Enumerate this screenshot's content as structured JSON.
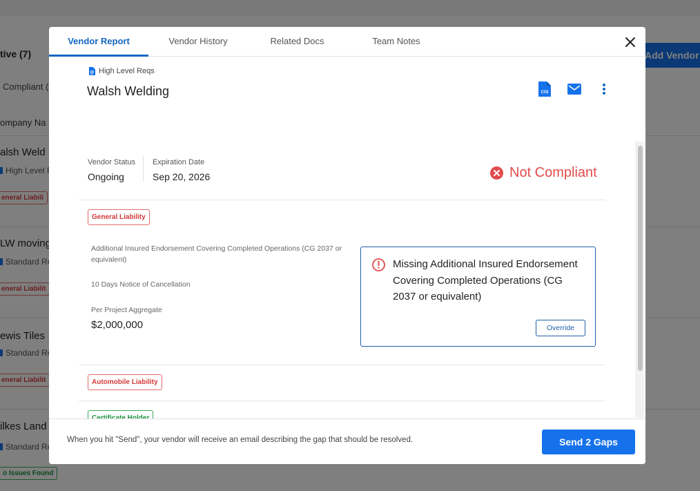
{
  "background": {
    "tab_label": "tive (7)",
    "add_vendor_label": "Add Vendor",
    "filter_label": "Compliant (",
    "column_header": "ompany Na",
    "rows": [
      {
        "name": "alsh Weld",
        "sub": "High Level R",
        "badge": "eneral Liabili"
      },
      {
        "name": "LW moving",
        "sub": "Standard Re",
        "badge": "eneral Liabilit"
      },
      {
        "name": "ewis Tiles",
        "sub": "Standard Re",
        "badge": "eneral Liabilit"
      },
      {
        "name": "ilkes Land",
        "sub": "Standard Re",
        "badge": "o Issues Found"
      }
    ]
  },
  "tabs": [
    {
      "label": "Vendor Report",
      "active": true
    },
    {
      "label": "Vendor History",
      "active": false
    },
    {
      "label": "Related Docs",
      "active": false
    },
    {
      "label": "Team Notes",
      "active": false
    }
  ],
  "vendor": {
    "requirements_set": "High Level Reqs",
    "name": "Walsh Welding",
    "status_label": "Vendor Status",
    "status_value": "Ongoing",
    "expiration_label": "Expiration Date",
    "expiration_value": "Sep 20, 2026",
    "compliance": "Not Compliant",
    "coi_icon_text": "COI"
  },
  "sections": {
    "general_liability": {
      "label": "General Liability",
      "requirements": [
        "Additional Insured Endorsement Covering Completed Operations (CG 2037 or equivalent)",
        "10 Days Notice of Cancellation",
        "Per Project Aggregate"
      ],
      "aggregate_value": "$2,000,000"
    },
    "automobile_liability": {
      "label": "Automobile Liability"
    },
    "certificate_holder": {
      "label": "Certificate Holder"
    }
  },
  "gap": {
    "message": "Missing Additional Insured Endorsement Covering Completed Operations (CG 2037 or equivalent)",
    "override_label": "Override"
  },
  "footer": {
    "note": "When you hit \"Send\", your vendor will receive an email describing the gap that should be resolved.",
    "send_label": "Send 2 Gaps"
  },
  "colors": {
    "accent": "#1672ec",
    "error": "#e24b4b",
    "success": "#1a8f3c"
  }
}
